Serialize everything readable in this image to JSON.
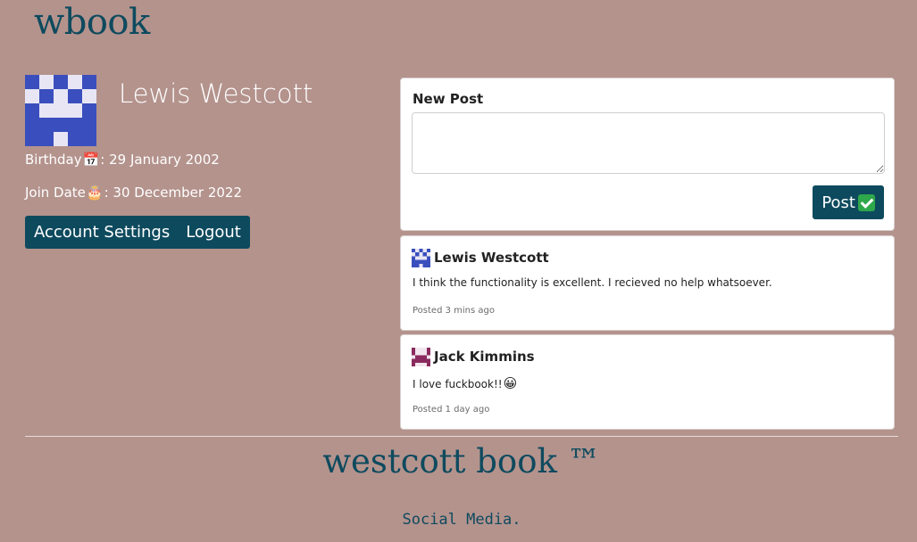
{
  "site": {
    "logo": "wbook"
  },
  "profile": {
    "name": "Lewis Westcott",
    "birthday_label": "Birthday",
    "birthday_icon": "calendar-icon",
    "birthday_value": ": 29 January 2002",
    "join_label": "Join Date",
    "join_icon": "cake-icon",
    "join_value": ": 30 December 2022",
    "account_settings_label": "Account Settings",
    "logout_label": "Logout"
  },
  "new_post": {
    "label": "New Post",
    "textarea_value": "",
    "post_button_label": "Post",
    "post_button_icon": "check-mark-icon"
  },
  "posts": [
    {
      "author": "Lewis Westcott",
      "body": "I think the functionality is excellent. I recieved no help whatsoever.",
      "time": "Posted 3 mins ago",
      "avatar_color": "#3a4fbd"
    },
    {
      "author": "Jack Kimmins",
      "body": "I love fuckbook!!",
      "body_icon": "smiley-icon",
      "time": "Posted 1 day ago",
      "avatar_color": "#8a2a5e"
    }
  ],
  "footer": {
    "title": "westcott book ™",
    "subtitle": "Social Media."
  },
  "colors": {
    "background": "#b4938d",
    "accent": "#0e4a5e",
    "avatar_blue": "#3a4fbd",
    "avatar_purple": "#8a2a5e"
  }
}
